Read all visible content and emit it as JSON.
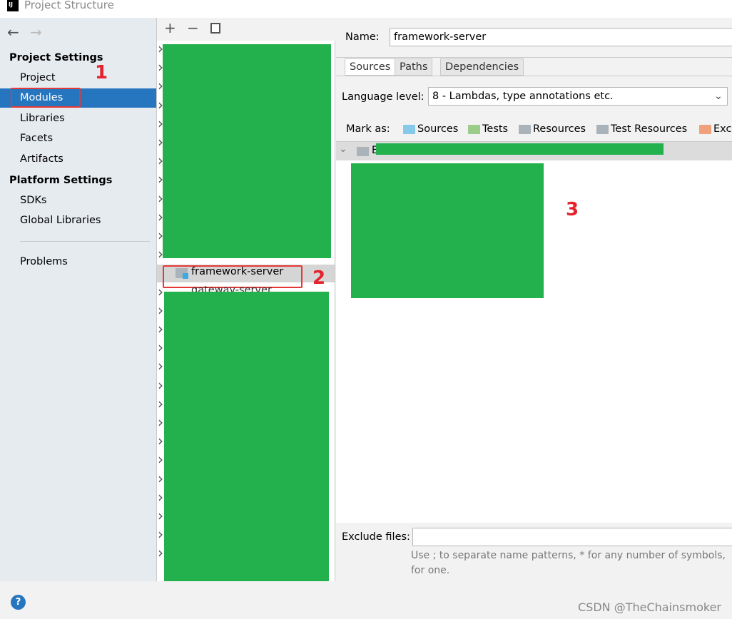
{
  "window": {
    "title": "Project Structure",
    "logo": "IJ"
  },
  "nav": {
    "back": "←",
    "forward": "→"
  },
  "sidebar": {
    "project_settings": "Project Settings",
    "items": [
      {
        "label": "Project"
      },
      {
        "label": "Modules"
      },
      {
        "label": "Libraries"
      },
      {
        "label": "Facets"
      },
      {
        "label": "Artifacts"
      }
    ],
    "platform_settings": "Platform Settings",
    "platform_items": [
      {
        "label": "SDKs"
      },
      {
        "label": "Global Libraries"
      }
    ],
    "problems": "Problems"
  },
  "annotations": {
    "one": "1",
    "two": "2",
    "three": "3"
  },
  "modules": {
    "toolbar": {
      "add": "+",
      "remove": "−",
      "copy": "copy-icon"
    },
    "selected": "framework-server",
    "next": "gateway-server"
  },
  "details": {
    "name_label": "Name:",
    "name_value": "framework-server",
    "tabs": [
      {
        "label": "Sources"
      },
      {
        "label": "Paths"
      },
      {
        "label": "Dependencies"
      }
    ],
    "language_label": "Language level:",
    "language_value": "8 - Lambdas, type annotations etc.",
    "mark_as": "Mark as:",
    "marks": [
      {
        "label": "Sources",
        "color": "#86c9e8"
      },
      {
        "label": "Tests",
        "color": "#9ccc8a"
      },
      {
        "label": "Resources",
        "color": "#aab2ba"
      },
      {
        "label": "Test Resources",
        "color": "#aab2ba"
      },
      {
        "label": "Exc",
        "color": "#f0a07a"
      }
    ],
    "root_prefix": "E:\\",
    "exclude_label": "Exclude files:",
    "exclude_value": "",
    "hint1": "Use ; to separate name patterns, * for any number of symbols,",
    "hint2": "for one."
  },
  "watermark": "CSDN @TheChainsmoker"
}
